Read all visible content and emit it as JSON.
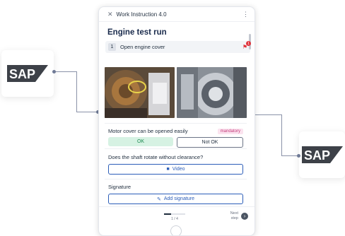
{
  "header": {
    "close_icon": "close-icon",
    "title": "Work Instruction 4.0",
    "menu_icon": "more-vertical-icon"
  },
  "page_title": "Engine test run",
  "step": {
    "number": "1",
    "label": "Open engine cover",
    "flag_icon": "flag-icon",
    "flag_count": "1"
  },
  "questions": [
    {
      "text": "Motor cover can be opened easily",
      "badge": "mandatory",
      "ok_label": "OK",
      "notok_label": "Not OK"
    },
    {
      "text": "Does the shaft rotate without clearance?",
      "action_label": "Video",
      "action_icon": "video-camera-icon"
    }
  ],
  "signature": {
    "title": "Signature",
    "action_label": "Add signature",
    "action_icon": "signature-pen-icon"
  },
  "footer": {
    "page_indicator": "1 / 4",
    "next_label": "Next step",
    "progress": 0.33
  },
  "brand": {
    "left_logo": "SAP",
    "right_logo": "SAP",
    "logo_color": "#1f2937"
  }
}
